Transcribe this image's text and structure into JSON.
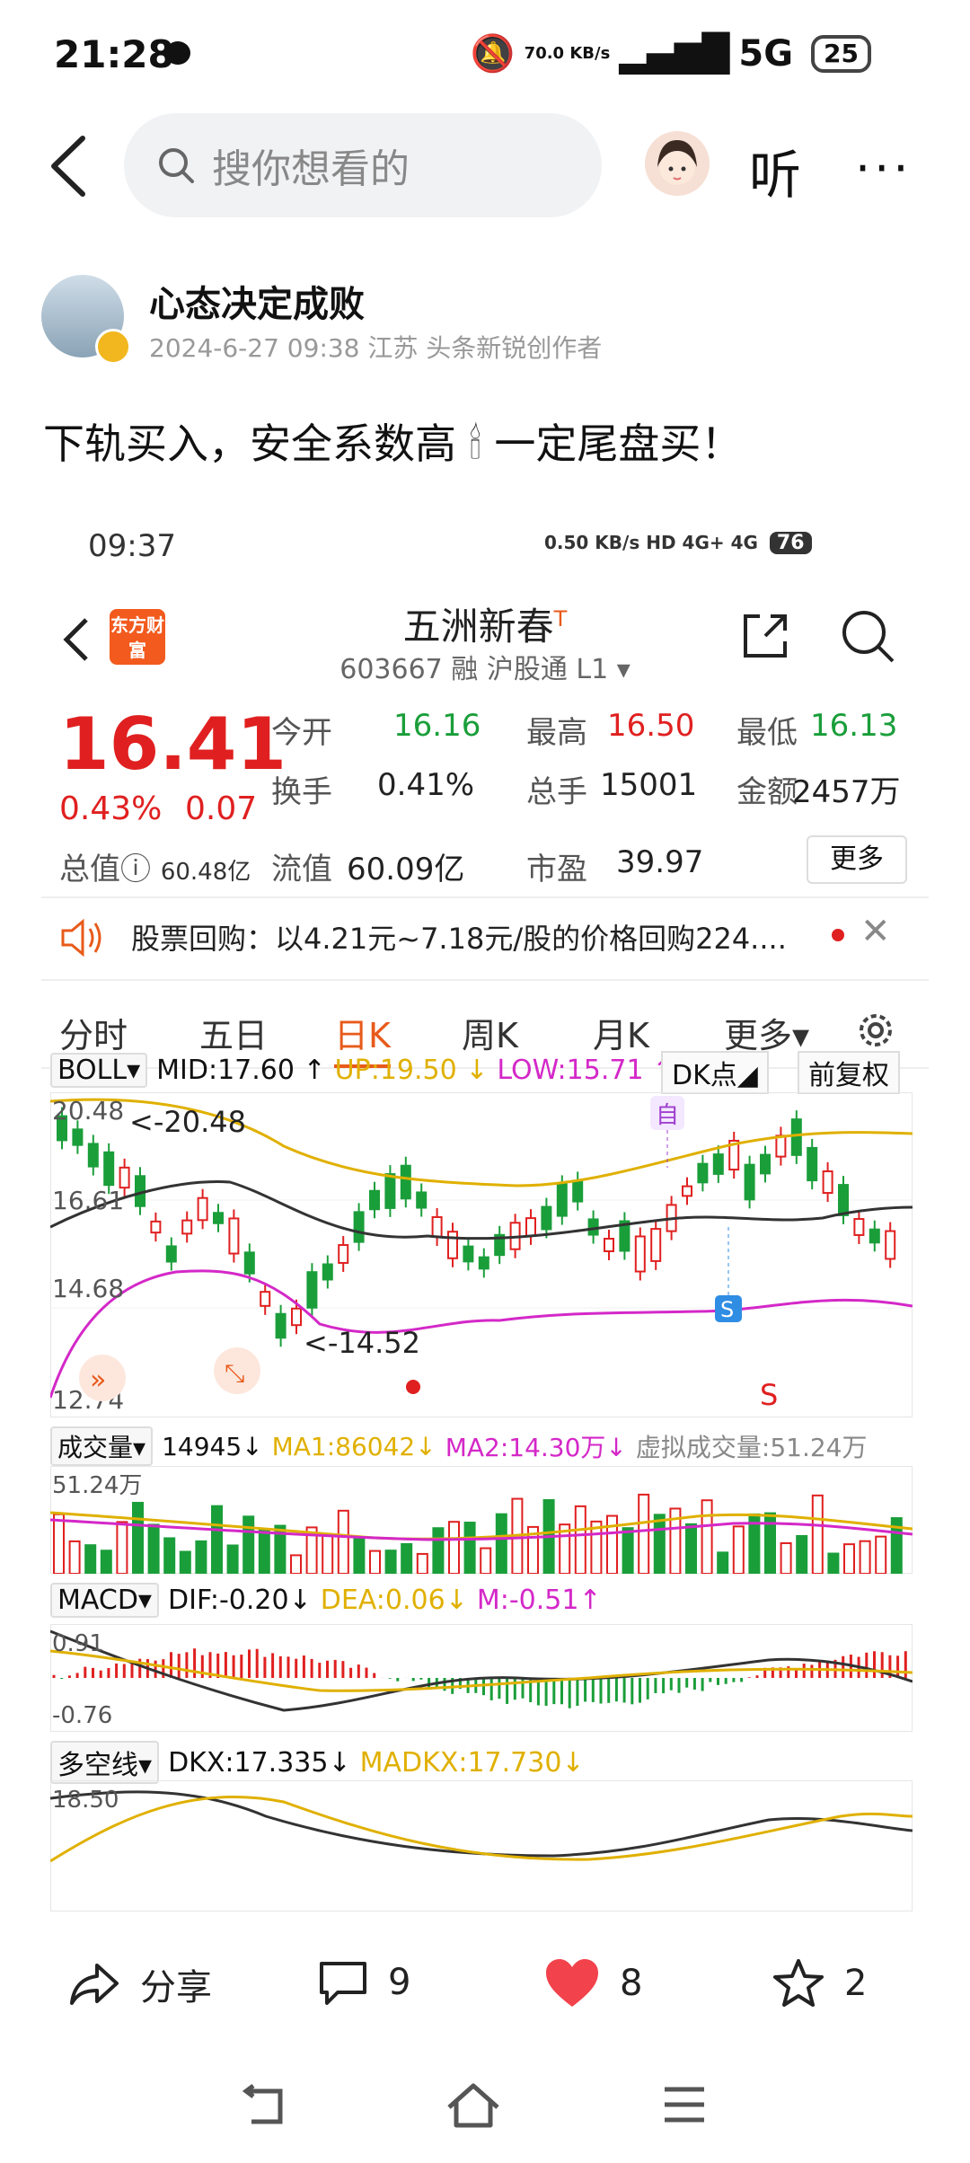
{
  "status_bar": {
    "time": "21:28",
    "net_speed": "70.0 KB/s",
    "network": "5G",
    "battery": "25"
  },
  "top_bar": {
    "search_placeholder": "搜你想看的",
    "listen_label": "听",
    "more_label": "···"
  },
  "author": {
    "name": "心态决定成败",
    "meta": "2024-6-27 09:38  江苏  头条新锐创作者"
  },
  "post": {
    "text_before": "下轨买入，安全系数高",
    "emoji": "🕯",
    "text_after": "一定尾盘买！"
  },
  "stock_screen": {
    "time": "09:37",
    "status_right": "0.50 KB/s  HD  4G+  4G",
    "battery": "76",
    "logo_text": "东方财富",
    "name": "五洲新春",
    "name_sup": "T",
    "code_line": "603667 融 沪股通 L1 ▾",
    "price": "16.41",
    "change_pct": "0.43%",
    "change_abs": "0.07",
    "quote": {
      "open_label": "今开",
      "open": "16.16",
      "high_label": "最高",
      "high": "16.50",
      "low_label": "最低",
      "low": "16.13",
      "turnover_label": "换手",
      "turnover": "0.41%",
      "volume_label": "总手",
      "volume": "15001",
      "amount_label": "金额",
      "amount": "2457万",
      "mktcap_label": "总值",
      "mktcap": "60.48亿",
      "float_label": "流值",
      "float": "60.09亿",
      "pe_label": "市盈",
      "pe": "39.97",
      "more_label": "更多"
    },
    "notice": "股票回购：以4.21元~7.18元/股的价格回购224....",
    "tabs": [
      "分时",
      "五日",
      "日K",
      "周K",
      "月K",
      "更多▾"
    ],
    "active_tab": "日K",
    "boll": {
      "name": "BOLL▾",
      "mid": "MID:17.60 ↑",
      "up": "UP:19.50 ↓",
      "low": "LOW:15.71 ↑",
      "dk": "DK点◢",
      "fq": "前复权"
    },
    "boll_axis": [
      "20.48",
      "16.61",
      "14.68",
      "12.74"
    ],
    "boll_notes": {
      "max": "<-20.48",
      "min": "<-14.52",
      "zi": "自",
      "s1": "S",
      "s2": "S"
    },
    "vol": {
      "name": "成交量▾",
      "value": "14945↓",
      "ma1": "MA1:86042↓",
      "ma2": "MA2:14.30万↓",
      "virtual": "虚拟成交量:51.24万",
      "axis": "51.24万"
    },
    "macd": {
      "name": "MACD▾",
      "dif": "DIF:-0.20↓",
      "dea": "DEA:0.06↓",
      "m": "M:-0.51↑",
      "axis_top": "0.91",
      "axis_bot": "-0.76"
    },
    "dkx": {
      "name": "多空线▾",
      "dkx": "DKX:17.335↓",
      "madkx": "MADKX:17.730↓",
      "axis_top": "18.50"
    }
  },
  "actions": {
    "share": "分享",
    "comments": "9",
    "likes": "8",
    "favorites": "2"
  },
  "colors": {
    "red": "#e02020",
    "green": "#1a9e3a",
    "orange": "#e85a1a",
    "yellow": "#e0b000",
    "magenta": "#d428c8"
  }
}
